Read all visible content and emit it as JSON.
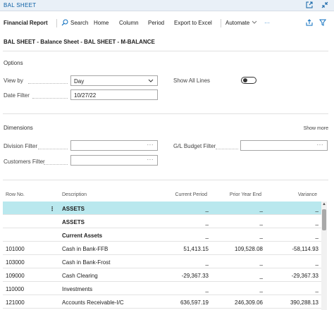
{
  "window": {
    "title": "BAL SHEET",
    "icons": [
      "open-in-new-window-icon",
      "collapse-icon"
    ]
  },
  "actionbar": {
    "title": "Financial Report",
    "search_label": "Search",
    "home_label": "Home",
    "column_label": "Column",
    "period_label": "Period",
    "export_label": "Export to Excel",
    "automate_label": "Automate",
    "more_label": "···",
    "icons": [
      "search-icon",
      "share-icon",
      "filter-icon",
      "chevron-down-icon"
    ]
  },
  "page": {
    "heading": "BAL SHEET - Balance Sheet - BAL SHEET - M-BALANCE"
  },
  "options": {
    "section_title": "Options",
    "view_by": {
      "label": "View by",
      "value": "Day"
    },
    "date_filter": {
      "label": "Date Filter",
      "value": "10/27/22"
    },
    "show_all_lines": {
      "label": "Show All Lines",
      "value": false
    }
  },
  "dimensions": {
    "section_title": "Dimensions",
    "show_more_label": "Show more",
    "division_filter": {
      "label": "Division Filter",
      "value": "",
      "assist": "···"
    },
    "customers_filter": {
      "label": "Customers Filter",
      "value": "",
      "assist": "···"
    },
    "gl_budget_filter": {
      "label": "G/L Budget Filter",
      "value": "",
      "assist": "···"
    }
  },
  "grid": {
    "columns": {
      "row_no": "Row No.",
      "description": "Description",
      "current_period": "Current Period",
      "prior_year_end": "Prior Year End",
      "variance": "Variance"
    },
    "row_menu": "⋮",
    "rows": [
      {
        "row_no": "",
        "description": "ASSETS",
        "bold": true,
        "selected": true,
        "current": "_",
        "prior": "_",
        "variance": "_"
      },
      {
        "row_no": "",
        "description": "ASSETS",
        "bold": true,
        "selected": false,
        "current": "_",
        "prior": "_",
        "variance": "_"
      },
      {
        "row_no": "",
        "description": "Current Assets",
        "bold": true,
        "selected": false,
        "current": "_",
        "prior": "_",
        "variance": "_"
      },
      {
        "row_no": "101000",
        "description": "Cash in Bank-FFB",
        "bold": false,
        "selected": false,
        "current": "51,413.15",
        "prior": "109,528.08",
        "variance": "-58,114.93"
      },
      {
        "row_no": "103000",
        "description": "Cash in Bank-Frost",
        "bold": false,
        "selected": false,
        "current": "_",
        "prior": "_",
        "variance": "_"
      },
      {
        "row_no": "109000",
        "description": "Cash Clearing",
        "bold": false,
        "selected": false,
        "current": "-29,367.33",
        "prior": "_",
        "variance": "-29,367.33"
      },
      {
        "row_no": "110000",
        "description": "Investments",
        "bold": false,
        "selected": false,
        "current": "_",
        "prior": "_",
        "variance": "_"
      },
      {
        "row_no": "121000",
        "description": "Accounts Receivable-I/C",
        "bold": false,
        "selected": false,
        "current": "636,597.19",
        "prior": "246,309.06",
        "variance": "390,288.13"
      }
    ]
  }
}
